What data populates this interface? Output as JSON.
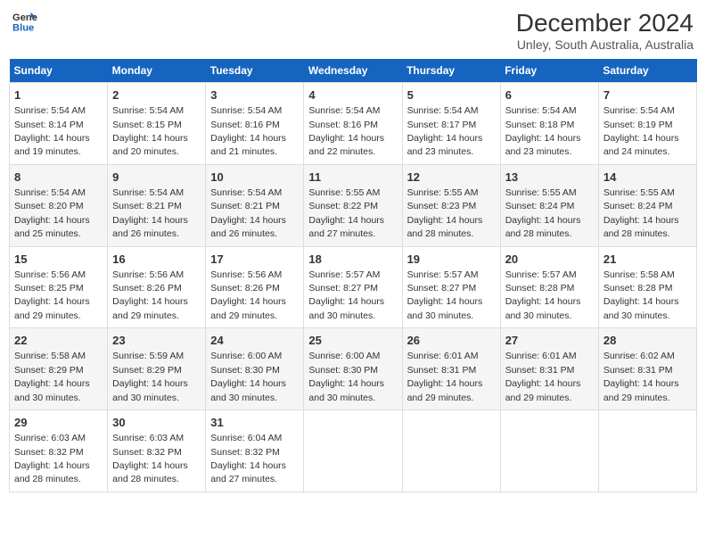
{
  "header": {
    "logo_line1": "General",
    "logo_line2": "Blue",
    "title": "December 2024",
    "subtitle": "Unley, South Australia, Australia"
  },
  "weekdays": [
    "Sunday",
    "Monday",
    "Tuesday",
    "Wednesday",
    "Thursday",
    "Friday",
    "Saturday"
  ],
  "weeks": [
    [
      {
        "day": "1",
        "sunrise": "5:54 AM",
        "sunset": "8:14 PM",
        "daylight": "14 hours and 19 minutes."
      },
      {
        "day": "2",
        "sunrise": "5:54 AM",
        "sunset": "8:15 PM",
        "daylight": "14 hours and 20 minutes."
      },
      {
        "day": "3",
        "sunrise": "5:54 AM",
        "sunset": "8:16 PM",
        "daylight": "14 hours and 21 minutes."
      },
      {
        "day": "4",
        "sunrise": "5:54 AM",
        "sunset": "8:16 PM",
        "daylight": "14 hours and 22 minutes."
      },
      {
        "day": "5",
        "sunrise": "5:54 AM",
        "sunset": "8:17 PM",
        "daylight": "14 hours and 23 minutes."
      },
      {
        "day": "6",
        "sunrise": "5:54 AM",
        "sunset": "8:18 PM",
        "daylight": "14 hours and 23 minutes."
      },
      {
        "day": "7",
        "sunrise": "5:54 AM",
        "sunset": "8:19 PM",
        "daylight": "14 hours and 24 minutes."
      }
    ],
    [
      {
        "day": "8",
        "sunrise": "5:54 AM",
        "sunset": "8:20 PM",
        "daylight": "14 hours and 25 minutes."
      },
      {
        "day": "9",
        "sunrise": "5:54 AM",
        "sunset": "8:21 PM",
        "daylight": "14 hours and 26 minutes."
      },
      {
        "day": "10",
        "sunrise": "5:54 AM",
        "sunset": "8:21 PM",
        "daylight": "14 hours and 26 minutes."
      },
      {
        "day": "11",
        "sunrise": "5:55 AM",
        "sunset": "8:22 PM",
        "daylight": "14 hours and 27 minutes."
      },
      {
        "day": "12",
        "sunrise": "5:55 AM",
        "sunset": "8:23 PM",
        "daylight": "14 hours and 28 minutes."
      },
      {
        "day": "13",
        "sunrise": "5:55 AM",
        "sunset": "8:24 PM",
        "daylight": "14 hours and 28 minutes."
      },
      {
        "day": "14",
        "sunrise": "5:55 AM",
        "sunset": "8:24 PM",
        "daylight": "14 hours and 28 minutes."
      }
    ],
    [
      {
        "day": "15",
        "sunrise": "5:56 AM",
        "sunset": "8:25 PM",
        "daylight": "14 hours and 29 minutes."
      },
      {
        "day": "16",
        "sunrise": "5:56 AM",
        "sunset": "8:26 PM",
        "daylight": "14 hours and 29 minutes."
      },
      {
        "day": "17",
        "sunrise": "5:56 AM",
        "sunset": "8:26 PM",
        "daylight": "14 hours and 29 minutes."
      },
      {
        "day": "18",
        "sunrise": "5:57 AM",
        "sunset": "8:27 PM",
        "daylight": "14 hours and 30 minutes."
      },
      {
        "day": "19",
        "sunrise": "5:57 AM",
        "sunset": "8:27 PM",
        "daylight": "14 hours and 30 minutes."
      },
      {
        "day": "20",
        "sunrise": "5:57 AM",
        "sunset": "8:28 PM",
        "daylight": "14 hours and 30 minutes."
      },
      {
        "day": "21",
        "sunrise": "5:58 AM",
        "sunset": "8:28 PM",
        "daylight": "14 hours and 30 minutes."
      }
    ],
    [
      {
        "day": "22",
        "sunrise": "5:58 AM",
        "sunset": "8:29 PM",
        "daylight": "14 hours and 30 minutes."
      },
      {
        "day": "23",
        "sunrise": "5:59 AM",
        "sunset": "8:29 PM",
        "daylight": "14 hours and 30 minutes."
      },
      {
        "day": "24",
        "sunrise": "6:00 AM",
        "sunset": "8:30 PM",
        "daylight": "14 hours and 30 minutes."
      },
      {
        "day": "25",
        "sunrise": "6:00 AM",
        "sunset": "8:30 PM",
        "daylight": "14 hours and 30 minutes."
      },
      {
        "day": "26",
        "sunrise": "6:01 AM",
        "sunset": "8:31 PM",
        "daylight": "14 hours and 29 minutes."
      },
      {
        "day": "27",
        "sunrise": "6:01 AM",
        "sunset": "8:31 PM",
        "daylight": "14 hours and 29 minutes."
      },
      {
        "day": "28",
        "sunrise": "6:02 AM",
        "sunset": "8:31 PM",
        "daylight": "14 hours and 29 minutes."
      }
    ],
    [
      {
        "day": "29",
        "sunrise": "6:03 AM",
        "sunset": "8:32 PM",
        "daylight": "14 hours and 28 minutes."
      },
      {
        "day": "30",
        "sunrise": "6:03 AM",
        "sunset": "8:32 PM",
        "daylight": "14 hours and 28 minutes."
      },
      {
        "day": "31",
        "sunrise": "6:04 AM",
        "sunset": "8:32 PM",
        "daylight": "14 hours and 27 minutes."
      },
      null,
      null,
      null,
      null
    ]
  ]
}
